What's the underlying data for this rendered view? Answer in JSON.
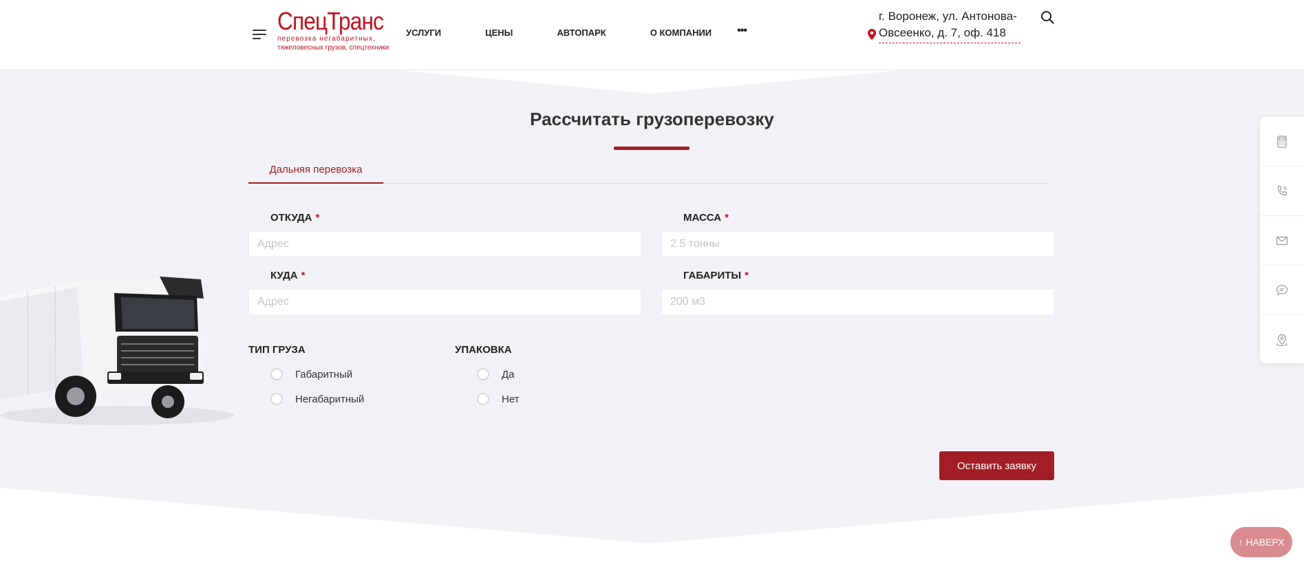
{
  "header": {
    "logo_name": "СпецТранс",
    "logo_tagline_1": "перевозка негабаритных,",
    "logo_tagline_2": "тяжеловесных грузов, спецтехники",
    "nav": [
      {
        "label": "УСЛУГИ"
      },
      {
        "label": "ЦЕНЫ"
      },
      {
        "label": "АВТОПАРК"
      },
      {
        "label": "О КОМПАНИИ"
      }
    ],
    "nav_more": "•••",
    "address": "г. Воронеж, ул. Антонова-Овсеенко, д. 7, оф. 418"
  },
  "calculator": {
    "title": "Рассчитать грузоперевозку",
    "tabs": [
      {
        "label": "Дальняя перевозка",
        "active": true
      }
    ],
    "fields": {
      "from": {
        "label": "ОТКУДА",
        "placeholder": "Адрес",
        "value": ""
      },
      "to": {
        "label": "КУДА",
        "placeholder": "Адрес",
        "value": ""
      },
      "mass": {
        "label": "МАССА",
        "placeholder": "2.5 тонны",
        "value": ""
      },
      "size": {
        "label": "ГАБАРИТЫ",
        "placeholder": "200 м3",
        "value": ""
      }
    },
    "required_mark": "*",
    "cargo_type": {
      "title": "ТИП ГРУЗА",
      "options": [
        {
          "label": "Габаритный",
          "checked": false
        },
        {
          "label": "Негабаритный",
          "checked": false
        }
      ]
    },
    "packaging": {
      "title": "УПАКОВКА",
      "options": [
        {
          "label": "Да",
          "checked": false
        },
        {
          "label": "Нет",
          "checked": false
        }
      ]
    },
    "submit_label": "Оставить заявку"
  },
  "side_panel": {
    "icons": [
      "calculator-icon",
      "phone-icon",
      "mail-icon",
      "chat-icon",
      "location-icon"
    ]
  },
  "back_to_top": "↑ НАВЕРХ",
  "colors": {
    "brand": "#a31d24",
    "logo_red": "#c1121f",
    "section_bg": "#f2f2f6",
    "back_to_top_bg": "#d98c90"
  }
}
